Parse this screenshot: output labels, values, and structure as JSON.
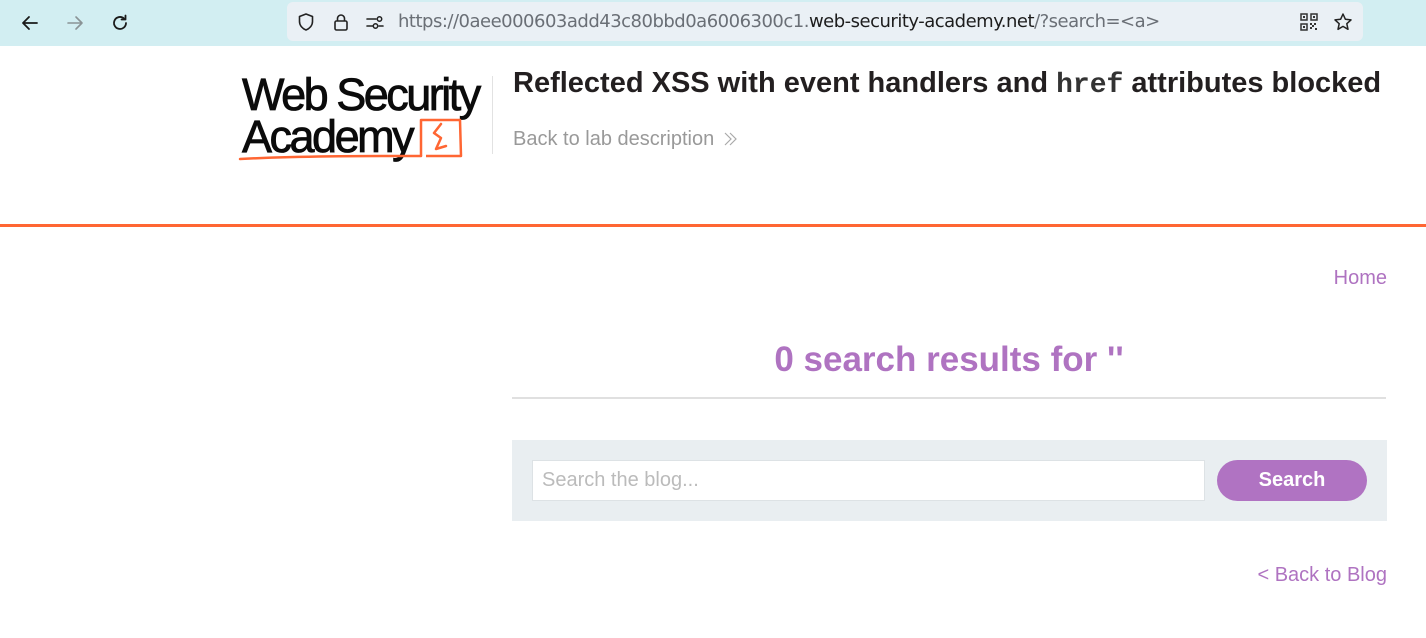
{
  "browser": {
    "url_prefix": "https://0aee000603add43c80bbd0a6006300c1.",
    "url_domain": "web-security-academy.net",
    "url_path": "/?search=<a>",
    "icons": {
      "back": "arrow-left",
      "forward": "arrow-right",
      "reload": "reload",
      "shield": "shield",
      "lock": "lock",
      "permissions": "sliders",
      "qr": "qr-code",
      "bookmark": "star"
    }
  },
  "header": {
    "logo_line1": "Web Security",
    "logo_line2": "Academy",
    "lab_title_pre": "Reflected XSS with event handlers and ",
    "lab_title_code": "href",
    "lab_title_post": " attributes blocked",
    "back_to_lab": "Back to lab description"
  },
  "colors": {
    "accent_orange": "#ff6633",
    "accent_purple": "#af73c1",
    "panel_bg": "#e9eef1"
  },
  "nav": {
    "home": "Home"
  },
  "search": {
    "results_heading": "0 search results for ''",
    "placeholder": "Search the blog...",
    "value": "",
    "button_label": "Search"
  },
  "footer": {
    "back_to_blog": "< Back to Blog"
  }
}
